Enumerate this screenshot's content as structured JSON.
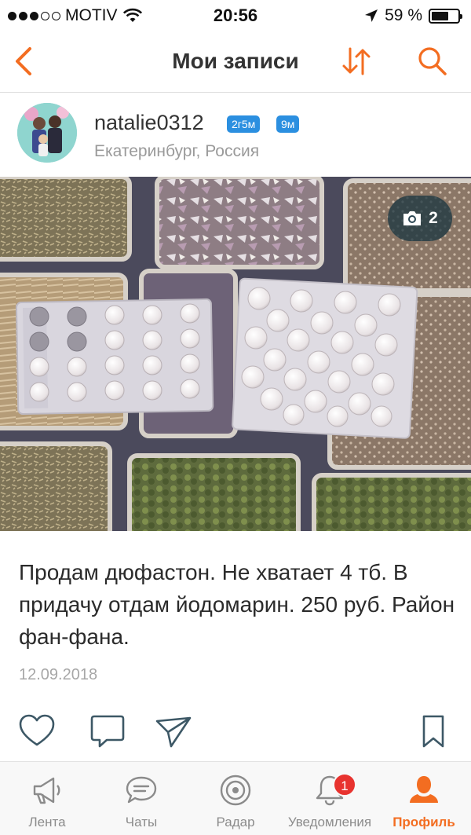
{
  "status_bar": {
    "carrier": "MOTIV",
    "time": "20:56",
    "battery": "59 %",
    "battery_level": 0.59,
    "signal_bars_filled": 3,
    "signal_bars_total": 5
  },
  "nav": {
    "title": "Мои записи",
    "back_icon": "chevron-left-icon",
    "sort_icon": "sort-arrows-icon",
    "search_icon": "search-icon",
    "accent_color": "#f36d21"
  },
  "post": {
    "username": "natalie0312",
    "badges": [
      "2г5м",
      "9м"
    ],
    "location": "Екатеринбург, Россия",
    "photo_count": "2",
    "text": "Продам дюфастон. Не хватает 4 тб. В придачу отдам йодомарин. 250 руб. Район фан-фана.",
    "date": "12.09.2018",
    "actions": [
      "heart-icon",
      "comment-icon",
      "share-icon",
      "bookmark-icon"
    ]
  },
  "tabbar": {
    "tabs": [
      {
        "label": "Лента",
        "icon": "megaphone-icon"
      },
      {
        "label": "Чаты",
        "icon": "chat-icon"
      },
      {
        "label": "Радар",
        "icon": "radar-icon"
      },
      {
        "label": "Уведомления",
        "icon": "bell-icon",
        "badge": "1"
      },
      {
        "label": "Профиль",
        "icon": "profile-icon",
        "active": true
      }
    ]
  }
}
